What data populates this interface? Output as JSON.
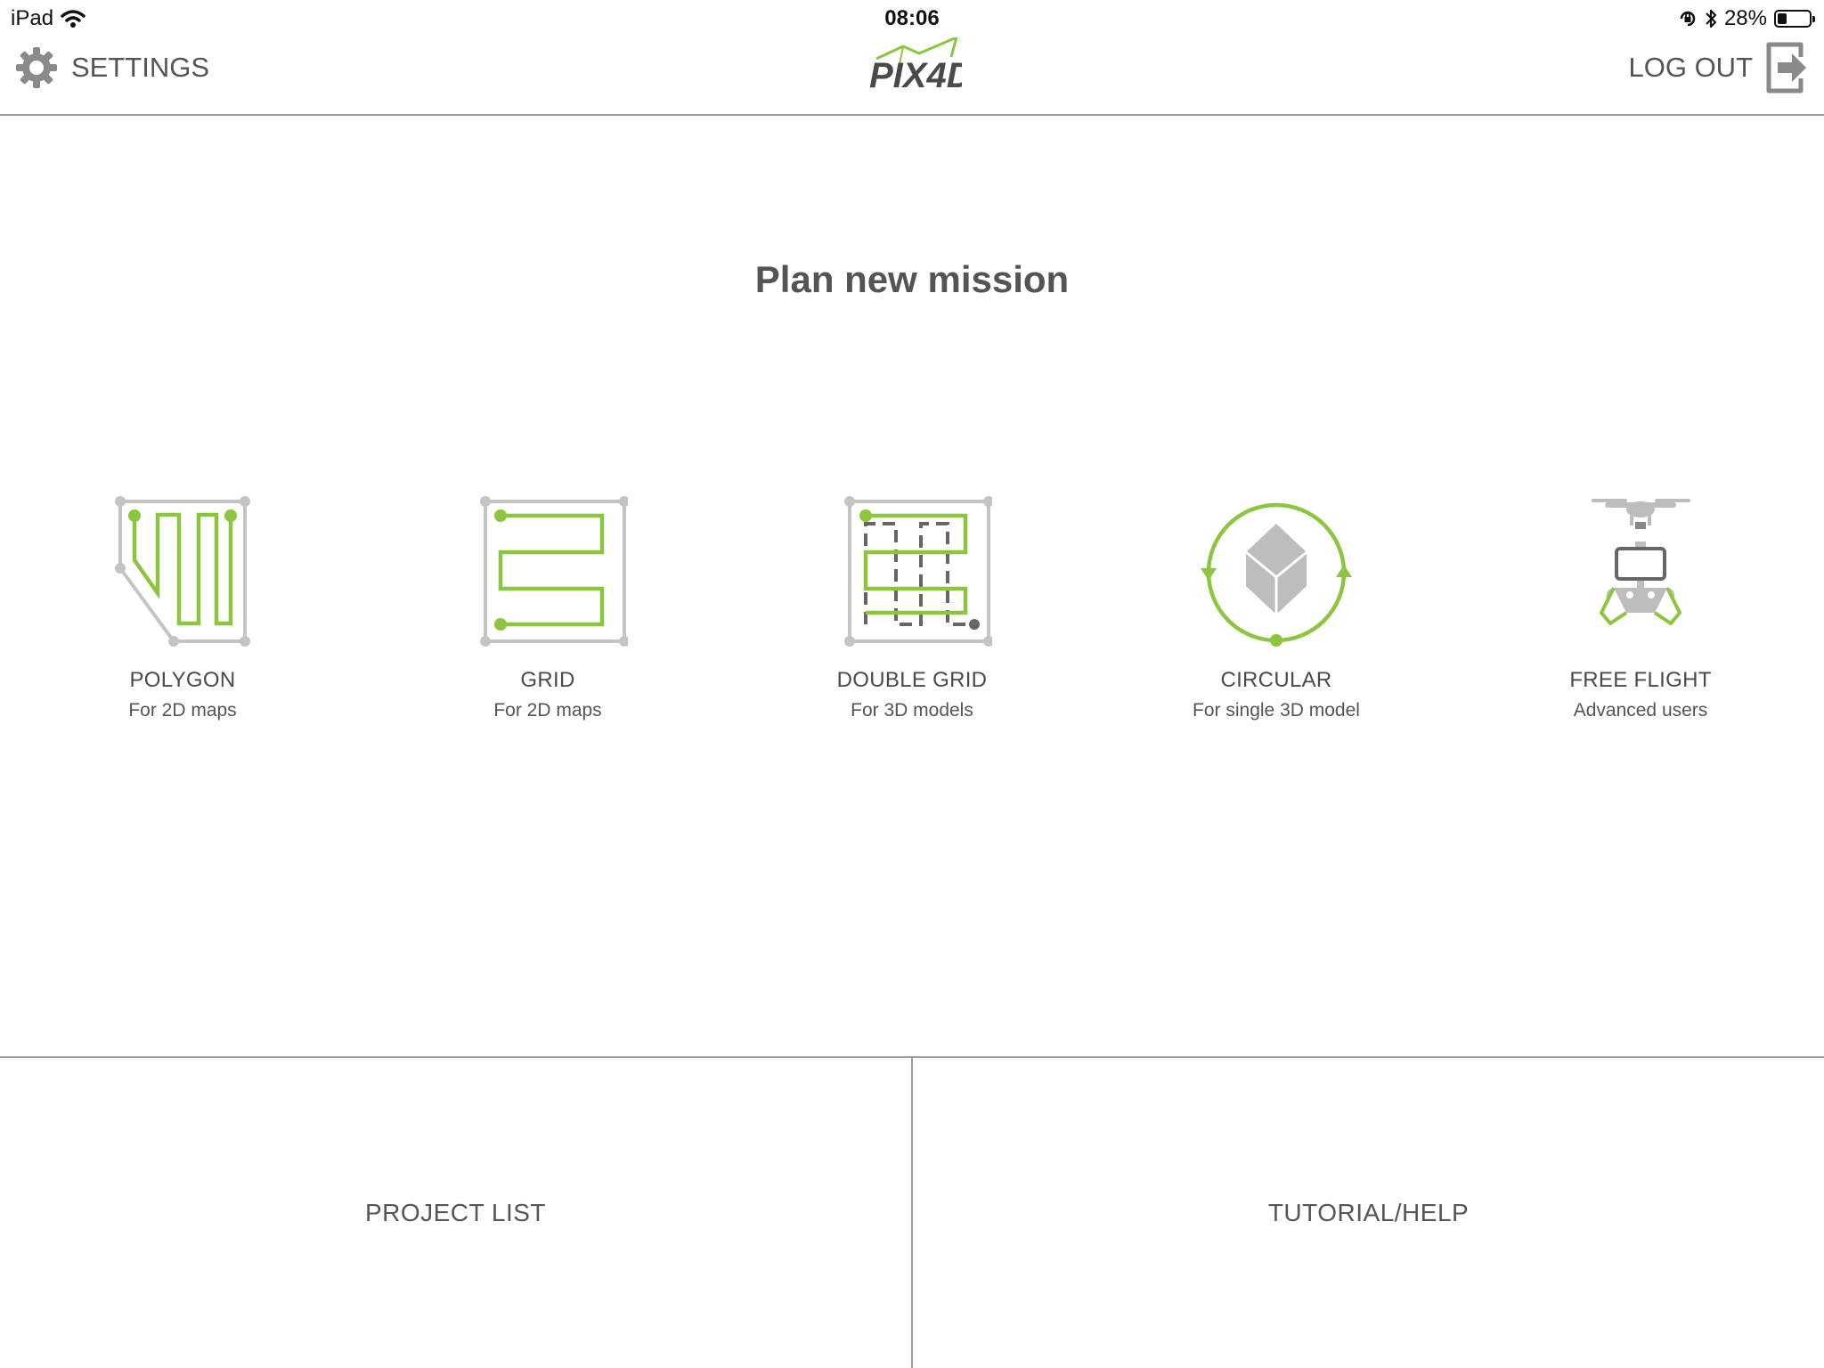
{
  "status_bar": {
    "device": "iPad",
    "time": "08:06",
    "battery": "28%"
  },
  "header": {
    "settings_label": "SETTINGS",
    "logout_label": "LOG OUT",
    "logo_text": "PIX4D"
  },
  "title": "Plan new mission",
  "modes": [
    {
      "label": "POLYGON",
      "subtitle": "For 2D maps"
    },
    {
      "label": "GRID",
      "subtitle": "For 2D maps"
    },
    {
      "label": "DOUBLE GRID",
      "subtitle": "For 3D models"
    },
    {
      "label": "CIRCULAR",
      "subtitle": "For single 3D model"
    },
    {
      "label": "FREE FLIGHT",
      "subtitle": "Advanced users"
    }
  ],
  "bottom": {
    "project_list_label": "PROJECT LIST",
    "tutorial_label": "TUTORIAL/HELP"
  },
  "colors": {
    "accent_green": "#8cc63f",
    "outline_gray": "#c4c4c4",
    "divider": "#9a9a9a"
  }
}
